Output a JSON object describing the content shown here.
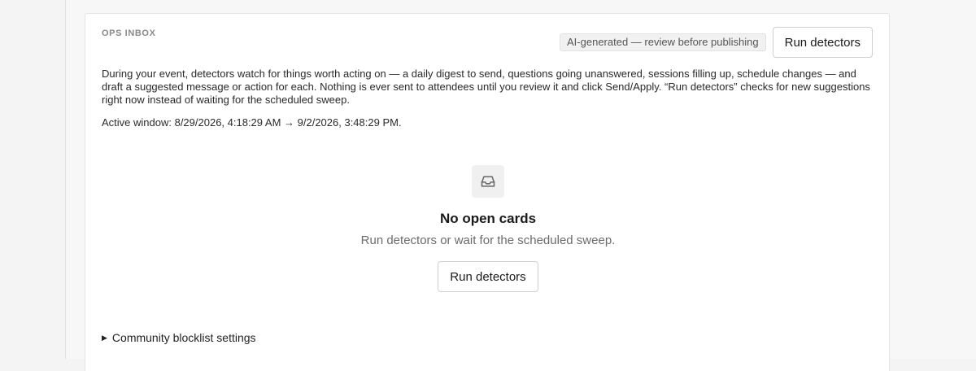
{
  "ops_inbox": {
    "eyebrow": "OPS INBOX",
    "ai_badge": "AI-generated — review before publishing",
    "run_button_label": "Run detectors",
    "description": "During your event, detectors watch for things worth acting on — a daily digest to send, questions going unanswered, sessions filling up, schedule changes — and draft a suggested message or action for each. Nothing is ever sent to attendees until you review it and click Send/Apply. “Run detectors” checks for new suggestions right now instead of waiting for the scheduled sweep.",
    "active_window": "Active window: 8/29/2026, 4:18:29 AM → 9/2/2026, 3:48:29 PM."
  },
  "empty_state": {
    "icon": "inbox-icon",
    "title": "No open cards",
    "subtitle": "Run detectors or wait for the scheduled sweep.",
    "button_label": "Run detectors"
  },
  "settings": {
    "blocklist_label": "Community blocklist settings"
  }
}
